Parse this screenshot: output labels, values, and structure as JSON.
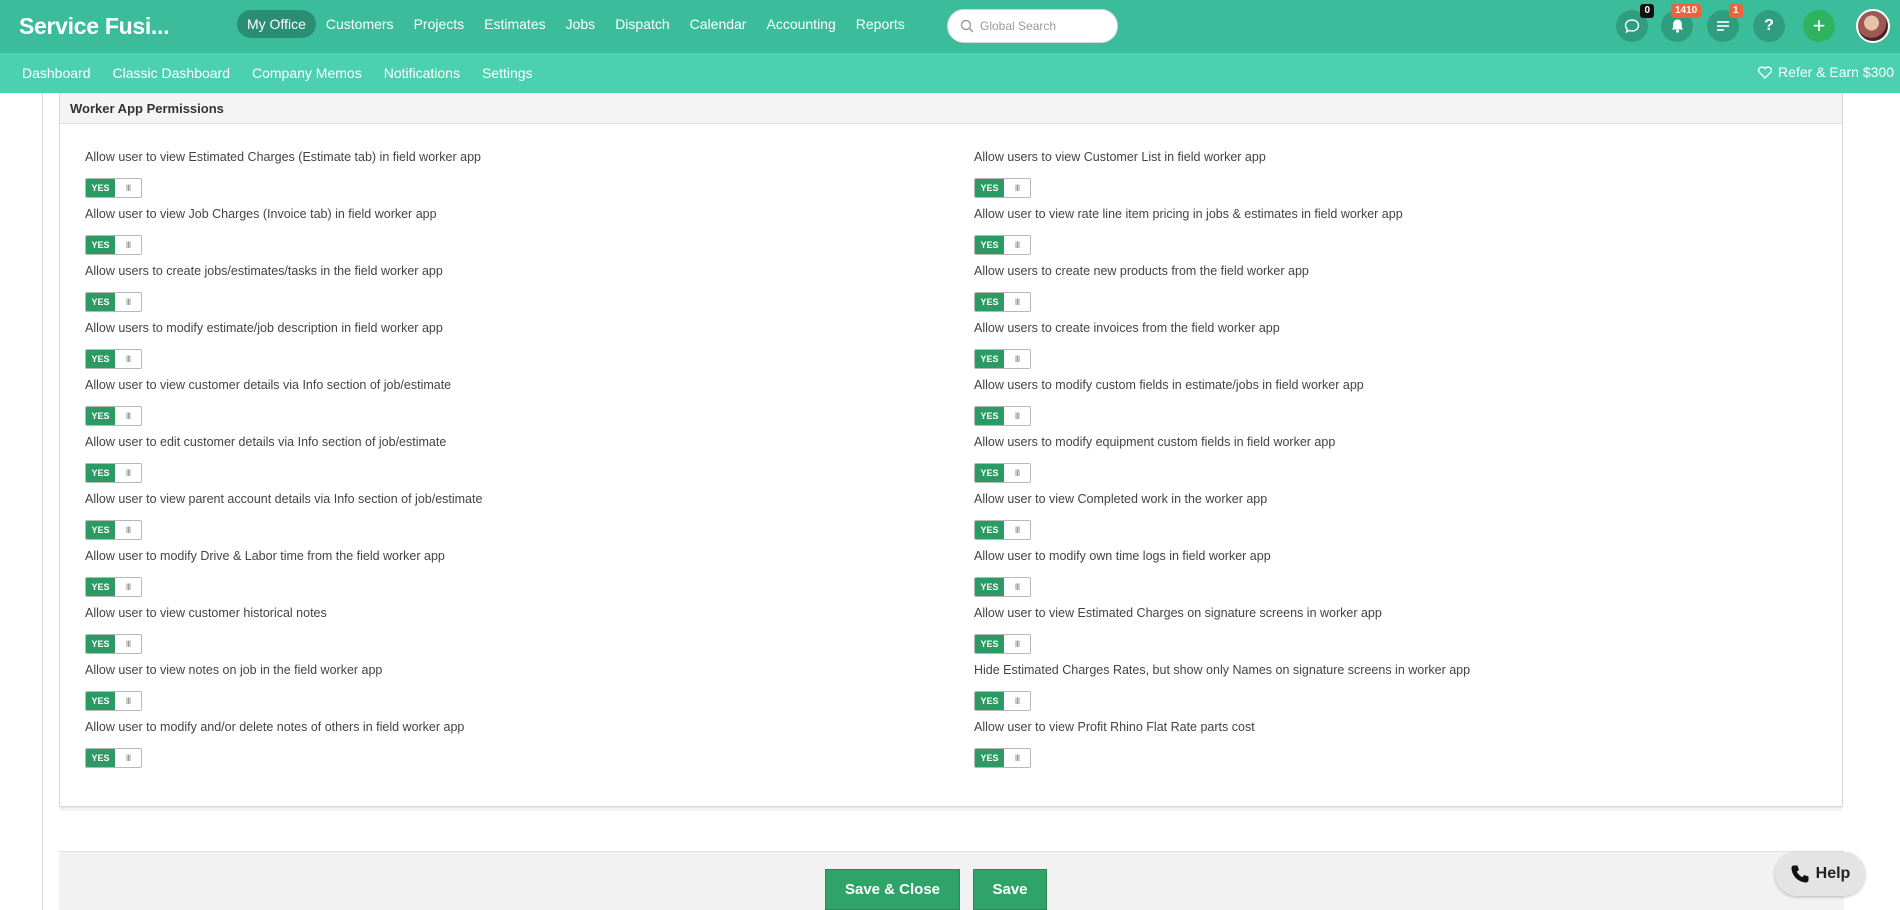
{
  "app": {
    "brand": "Service Fusi..."
  },
  "nav": {
    "items": [
      {
        "label": "My Office",
        "active": true
      },
      {
        "label": "Customers"
      },
      {
        "label": "Projects"
      },
      {
        "label": "Estimates"
      },
      {
        "label": "Jobs"
      },
      {
        "label": "Dispatch"
      },
      {
        "label": "Calendar"
      },
      {
        "label": "Accounting"
      },
      {
        "label": "Reports"
      }
    ]
  },
  "search": {
    "placeholder": "Global Search",
    "value": ""
  },
  "header_icons": {
    "chat_badge": "0",
    "notifications_badge": "1410",
    "tasks_badge": "1",
    "help_glyph": "?",
    "plus_glyph": "+"
  },
  "subnav": {
    "items": [
      "Dashboard",
      "Classic Dashboard",
      "Company Memos",
      "Notifications",
      "Settings"
    ],
    "refer": "Refer & Earn $300"
  },
  "panel": {
    "title": "Worker App Permissions",
    "toggle_label": "YES",
    "toggle_grip": "III",
    "left": [
      "Allow user to view Estimated Charges (Estimate tab) in field worker app",
      "Allow user to view Job Charges (Invoice tab) in field worker app",
      "Allow users to create jobs/estimates/tasks in the field worker app",
      "Allow users to modify estimate/job description in field worker app",
      "Allow user to view customer details via Info section of job/estimate",
      "Allow user to edit customer details via Info section of job/estimate",
      "Allow user to view parent account details via Info section of job/estimate",
      "Allow user to modify Drive & Labor time from the field worker app",
      "Allow user to view customer historical notes",
      "Allow user to view notes on job in the field worker app",
      "Allow user to modify and/or delete notes of others in field worker app"
    ],
    "right": [
      "Allow users to view Customer List in field worker app",
      "Allow user to view rate line item pricing in jobs & estimates in field worker app",
      "Allow users to create new products from the field worker app",
      "Allow users to create invoices from the field worker app",
      "Allow users to modify custom fields in estimate/jobs in field worker app",
      "Allow users to modify equipment custom fields in field worker app",
      "Allow user to view Completed work in the worker app",
      "Allow user to modify own time logs in field worker app",
      "Allow user to view Estimated Charges on signature screens in worker app",
      "Hide Estimated Charges Rates, but show only Names on signature screens in worker app",
      "Allow user to view Profit Rhino Flat Rate parts cost"
    ]
  },
  "footer": {
    "save_close": "Save & Close",
    "save": "Save"
  },
  "help": {
    "label": "Help"
  }
}
